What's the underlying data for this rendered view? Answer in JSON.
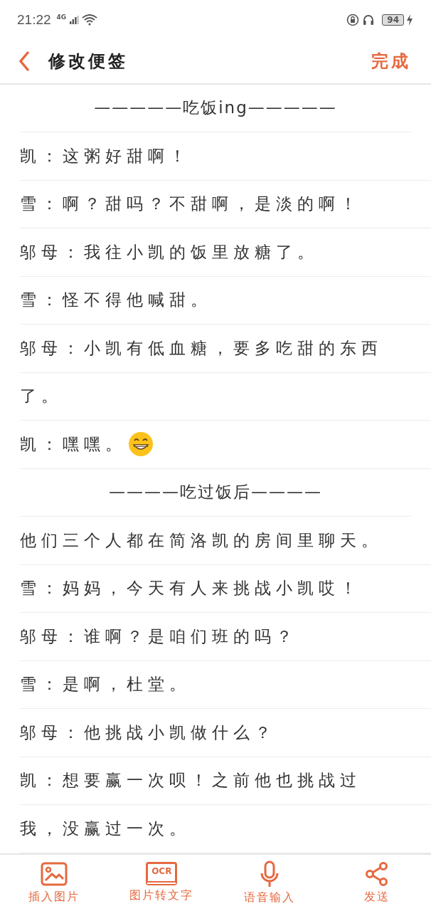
{
  "status_bar": {
    "time": "21:22",
    "network": "4G",
    "battery": "94"
  },
  "header": {
    "title": "修改便签",
    "done": "完成"
  },
  "lines": [
    {
      "kind": "heading",
      "text": "—————吃饭ing—————"
    },
    {
      "kind": "line",
      "text": "凯：这粥好甜啊！"
    },
    {
      "kind": "line",
      "text": "雪：啊？甜吗？不甜啊，是淡的啊！"
    },
    {
      "kind": "line",
      "text": "邬母：我往小凯的饭里放糖了。"
    },
    {
      "kind": "line",
      "text": "雪：怪不得他喊甜。"
    },
    {
      "kind": "line",
      "text": "邬母：小凯有低血糖，要多吃甜的东西"
    },
    {
      "kind": "line",
      "text": "了。"
    },
    {
      "kind": "line",
      "text": "凯：嘿嘿。",
      "emoji": true
    },
    {
      "kind": "heading",
      "text": "————吃过饭后————"
    },
    {
      "kind": "line",
      "text": "他们三个人都在简洛凯的房间里聊天。"
    },
    {
      "kind": "line",
      "text": "雪：妈妈，今天有人来挑战小凯哎！"
    },
    {
      "kind": "line",
      "text": "邬母：谁啊？是咱们班的吗？"
    },
    {
      "kind": "line",
      "text": "雪：是啊，杜堂。"
    },
    {
      "kind": "line",
      "text": "邬母：他挑战小凯做什么？"
    },
    {
      "kind": "line",
      "text": "凯：想要赢一次呗！之前他也挑战过"
    },
    {
      "kind": "line",
      "text": "我，没赢过一次。"
    }
  ],
  "toolbar": [
    {
      "kind": "image",
      "label": "插入图片"
    },
    {
      "kind": "ocr",
      "icon_text": "OCR",
      "label": "图片转文字"
    },
    {
      "kind": "mic",
      "label": "语音输入"
    },
    {
      "kind": "share",
      "label": "发送"
    }
  ]
}
